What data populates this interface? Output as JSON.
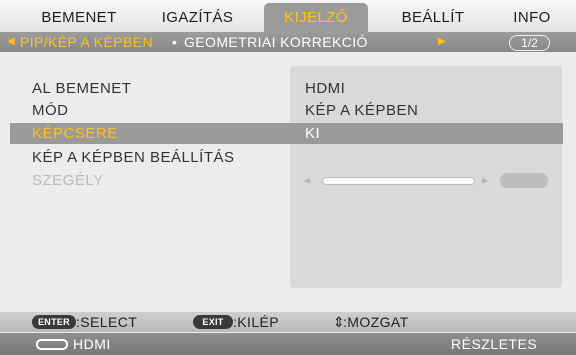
{
  "tabs": [
    {
      "label": "BEMENET"
    },
    {
      "label": "IGAZÍTÁS"
    },
    {
      "label": "KIJELZŐ",
      "active": true
    },
    {
      "label": "BEÁLLÍT"
    },
    {
      "label": "INFO"
    }
  ],
  "subheader": {
    "left_arrow_icon": "triangle-left-icon",
    "item_active": "PIP/KÉP A KÉPBEN",
    "separator": "•",
    "item_next": "GEOMETRIAI KORREKCIÓ",
    "right_arrow_icon": "triangle-right-icon",
    "page_indicator": "1/2"
  },
  "menu": {
    "rows": [
      {
        "label": "AL BEMENET",
        "value": "HDMI"
      },
      {
        "label": "MÓD",
        "value": "KÉP A KÉPBEN"
      },
      {
        "label": "KÉPCSERE",
        "value": "KI",
        "selected": true
      },
      {
        "label": "KÉP A KÉPBEN BEÁLLÍTÁS",
        "value": ""
      },
      {
        "label": "SZEGÉLY",
        "value": "",
        "disabled": true
      }
    ],
    "border_slider": {
      "disabled": true
    }
  },
  "hints": {
    "enter_key": "ENTER",
    "enter_action": ":SELECT",
    "exit_key": "EXIT",
    "exit_action": ":KILÉP",
    "move_symbol": "⇕",
    "move_action": ":MOZGAT"
  },
  "status": {
    "source_icon": "hdmi-port-icon",
    "source": "HDMI",
    "details": "RÉSZLETES"
  },
  "colors": {
    "active_tab_text": "#ffc21a",
    "selected_text": "#ffc21a",
    "selected_bg": "#9a9a9a",
    "disabled_text": "#bcbcbc"
  }
}
